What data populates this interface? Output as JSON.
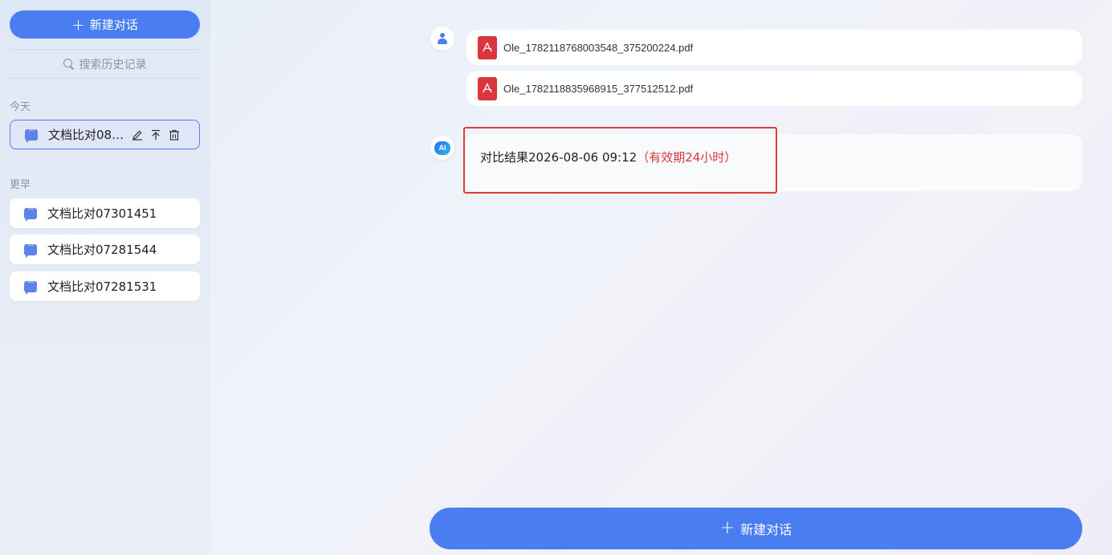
{
  "sidebar": {
    "new_chat_label": "新建对话",
    "search_placeholder": "搜索历史记录",
    "today_label": "今天",
    "earlier_label": "更早",
    "today_items": [
      {
        "label": "文档比对08…"
      }
    ],
    "earlier_items": [
      {
        "label": "文档比对07301451"
      },
      {
        "label": "文档比对07281544"
      },
      {
        "label": "文档比对07281531"
      }
    ]
  },
  "chat": {
    "files": [
      {
        "name": "Ole_1782118768003548_375200224.pdf"
      },
      {
        "name": "Ole_1782118835968915_377512512.pdf"
      }
    ],
    "ai_avatar_text": "AI",
    "result": {
      "prefix": "对比结果",
      "datetime": "2026-08-06 09:12",
      "validity": "（有效期24小时）"
    },
    "new_chat_label": "新建对话"
  },
  "colors": {
    "accent": "#4a7ef0",
    "pdf_red": "#d9363e",
    "highlight_border": "#e0393e"
  },
  "icons": {
    "pdf": "pdf-file-icon",
    "chat": "chat-bubble-icon",
    "edit": "pencil-icon",
    "pin": "pin-to-top-icon",
    "delete": "trash-icon"
  }
}
